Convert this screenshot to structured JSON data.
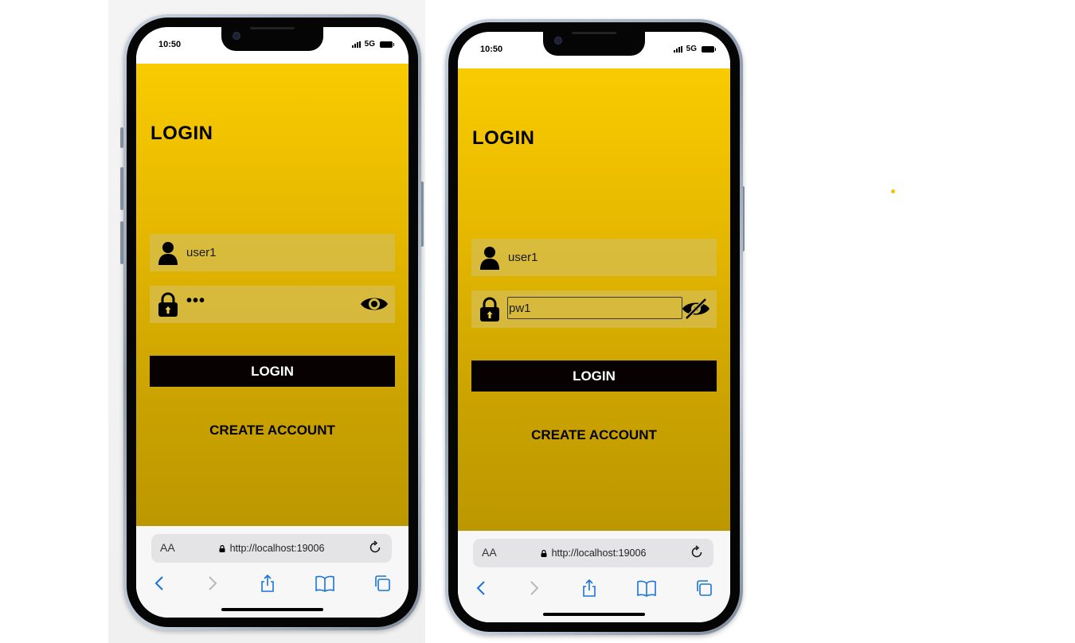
{
  "colors": {
    "brand_yellow": "#f9cb00",
    "brand_dark_yellow": "#bc9800",
    "button_black": "#070102",
    "browser_link_blue": "#1a73d9"
  },
  "phones": [
    {
      "status": {
        "time": "10:50",
        "network": "5G"
      },
      "app": {
        "title": "LOGIN",
        "username_value": "user1",
        "password_display": "•••",
        "password_visible": false,
        "visibility_icon": "eye-icon",
        "login_button_label": "LOGIN",
        "create_account_label": "CREATE ACCOUNT"
      },
      "browser": {
        "text_size_label": "AA",
        "url": "http://localhost:19006"
      }
    },
    {
      "status": {
        "time": "10:50",
        "network": "5G"
      },
      "app": {
        "title": "LOGIN",
        "username_value": "user1",
        "password_value": "pw1",
        "password_visible": true,
        "visibility_icon": "eye-off-icon",
        "login_button_label": "LOGIN",
        "create_account_label": "CREATE ACCOUNT"
      },
      "browser": {
        "text_size_label": "AA",
        "url": "http://localhost:19006"
      }
    }
  ]
}
